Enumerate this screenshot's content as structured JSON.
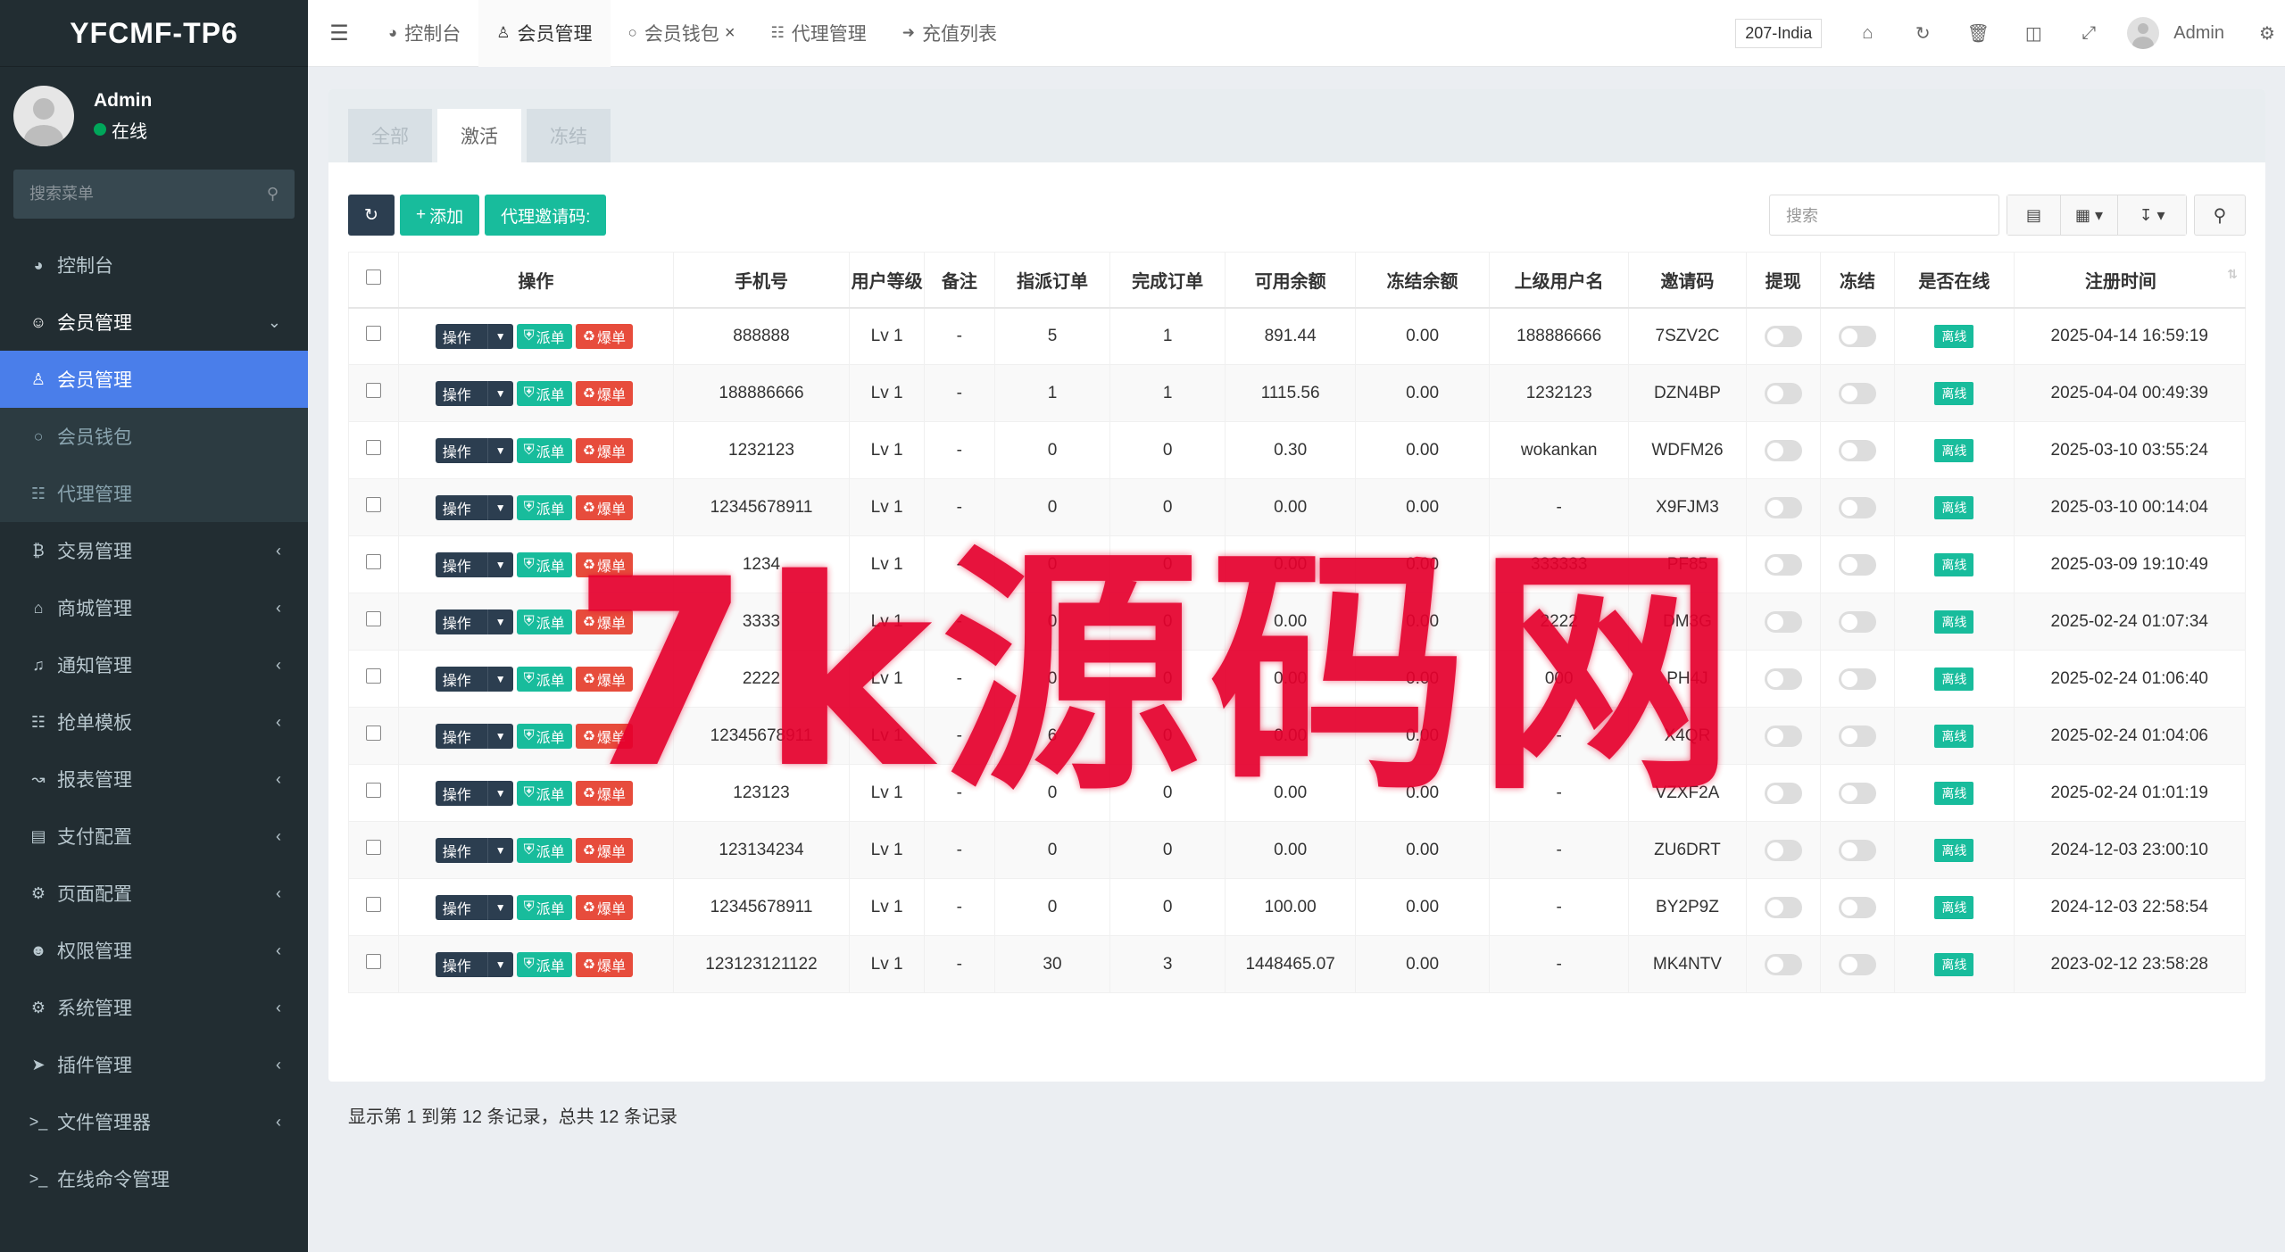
{
  "app": {
    "logo": "YFCMF-TP6"
  },
  "user_panel": {
    "name": "Admin",
    "status": "在线"
  },
  "sidebar": {
    "search_placeholder": "搜索菜单",
    "items": [
      {
        "label": "控制台",
        "icon": "dashboard-icon",
        "state": "normal"
      },
      {
        "label": "会员管理",
        "icon": "user-circle-icon",
        "state": "open"
      },
      {
        "label": "会员管理",
        "icon": "user-icon",
        "state": "sub-active"
      },
      {
        "label": "会员钱包",
        "icon": "wallet-icon",
        "state": "sub"
      },
      {
        "label": "代理管理",
        "icon": "sitemap-icon",
        "state": "sub"
      },
      {
        "label": "交易管理",
        "icon": "bitcoin-icon",
        "state": "normal"
      },
      {
        "label": "商城管理",
        "icon": "home-icon",
        "state": "normal"
      },
      {
        "label": "通知管理",
        "icon": "bell-icon",
        "state": "normal"
      },
      {
        "label": "抢单模板",
        "icon": "sitemap-icon",
        "state": "normal"
      },
      {
        "label": "报表管理",
        "icon": "chart-line-icon",
        "state": "normal"
      },
      {
        "label": "支付配置",
        "icon": "credit-card-icon",
        "state": "normal"
      },
      {
        "label": "页面配置",
        "icon": "gear-icon",
        "state": "normal"
      },
      {
        "label": "权限管理",
        "icon": "users-icon",
        "state": "normal"
      },
      {
        "label": "系统管理",
        "icon": "gears-icon",
        "state": "normal"
      },
      {
        "label": "插件管理",
        "icon": "rocket-icon",
        "state": "normal"
      },
      {
        "label": "文件管理器",
        "icon": "terminal-icon",
        "state": "normal"
      },
      {
        "label": "在线命令管理",
        "icon": "terminal-icon",
        "state": "normal"
      }
    ]
  },
  "navbar": {
    "tabs": [
      {
        "label": "控制台",
        "icon": "dashboard-icon"
      },
      {
        "label": "会员管理",
        "icon": "user-icon"
      },
      {
        "label": "会员钱包",
        "icon": "wallet-icon"
      },
      {
        "label": "代理管理",
        "icon": "sitemap-icon"
      },
      {
        "label": "充值列表",
        "icon": "sign-in-icon"
      }
    ],
    "site_select": "207-India",
    "user": "Admin"
  },
  "subtabs": [
    "全部",
    "激活",
    "冻结"
  ],
  "toolbar": {
    "add_label": "添加",
    "invite_label": "代理邀请码:",
    "search_placeholder": "搜索"
  },
  "table": {
    "columns": [
      "操作",
      "手机号",
      "用户等级",
      "备注",
      "指派订单",
      "完成订单",
      "可用余额",
      "冻结余额",
      "上级用户名",
      "邀请码",
      "提现",
      "冻结",
      "是否在线",
      "注册时间"
    ],
    "action_labels": {
      "op": "操作",
      "dispatch": "派单",
      "burst": "爆单"
    },
    "online_badge": "离线",
    "rows": [
      {
        "phone": "888888",
        "level": "Lv 1",
        "remark": "-",
        "assigned": "5",
        "done": "1",
        "balance": "891.44",
        "frozen": "0.00",
        "parent": "188886666",
        "code": "7SZV2C",
        "time": "2025-04-14 16:59:19"
      },
      {
        "phone": "188886666",
        "level": "Lv 1",
        "remark": "-",
        "assigned": "1",
        "done": "1",
        "balance": "1115.56",
        "frozen": "0.00",
        "parent": "1232123",
        "code": "DZN4BP",
        "time": "2025-04-04 00:49:39"
      },
      {
        "phone": "1232123",
        "level": "Lv 1",
        "remark": "-",
        "assigned": "0",
        "done": "0",
        "balance": "0.30",
        "frozen": "0.00",
        "parent": "wokankan",
        "code": "WDFM26",
        "time": "2025-03-10 03:55:24"
      },
      {
        "phone": "12345678911",
        "level": "Lv 1",
        "remark": "-",
        "assigned": "0",
        "done": "0",
        "balance": "0.00",
        "frozen": "0.00",
        "parent": "-",
        "code": "X9FJM3",
        "time": "2025-03-10 00:14:04"
      },
      {
        "phone": "1234",
        "level": "Lv 1",
        "remark": "-",
        "assigned": "0",
        "done": "0",
        "balance": "0.00",
        "frozen": "0.00",
        "parent": "333333",
        "code": "PF85",
        "time": "2025-03-09 19:10:49"
      },
      {
        "phone": "3333",
        "level": "Lv 1",
        "remark": "-",
        "assigned": "0",
        "done": "0",
        "balance": "0.00",
        "frozen": "0.00",
        "parent": "2222",
        "code": "DM3G",
        "time": "2025-02-24 01:07:34"
      },
      {
        "phone": "2222",
        "level": "Lv 1",
        "remark": "-",
        "assigned": "0",
        "done": "0",
        "balance": "0.00",
        "frozen": "0.00",
        "parent": "000",
        "code": "PH4J",
        "time": "2025-02-24 01:06:40"
      },
      {
        "phone": "12345678911",
        "level": "Lv 1",
        "remark": "-",
        "assigned": "6",
        "done": "0",
        "balance": "0.00",
        "frozen": "0.00",
        "parent": "-",
        "code": "X4QR",
        "time": "2025-02-24 01:04:06"
      },
      {
        "phone": "123123",
        "level": "Lv 1",
        "remark": "-",
        "assigned": "0",
        "done": "0",
        "balance": "0.00",
        "frozen": "0.00",
        "parent": "-",
        "code": "VZXF2A",
        "time": "2025-02-24 01:01:19"
      },
      {
        "phone": "123134234",
        "level": "Lv 1",
        "remark": "-",
        "assigned": "0",
        "done": "0",
        "balance": "0.00",
        "frozen": "0.00",
        "parent": "-",
        "code": "ZU6DRT",
        "time": "2024-12-03 23:00:10"
      },
      {
        "phone": "12345678911",
        "level": "Lv 1",
        "remark": "-",
        "assigned": "0",
        "done": "0",
        "balance": "100.00",
        "frozen": "0.00",
        "parent": "-",
        "code": "BY2P9Z",
        "time": "2024-12-03 22:58:54"
      },
      {
        "phone": "123123121122",
        "level": "Lv 1",
        "remark": "-",
        "assigned": "30",
        "done": "3",
        "balance": "1448465.07",
        "frozen": "0.00",
        "parent": "-",
        "code": "MK4NTV",
        "time": "2023-02-12 23:58:28"
      }
    ]
  },
  "pagination_text": "显示第 1 到第 12 条记录，总共 12 条记录",
  "watermark": "7k源码网"
}
